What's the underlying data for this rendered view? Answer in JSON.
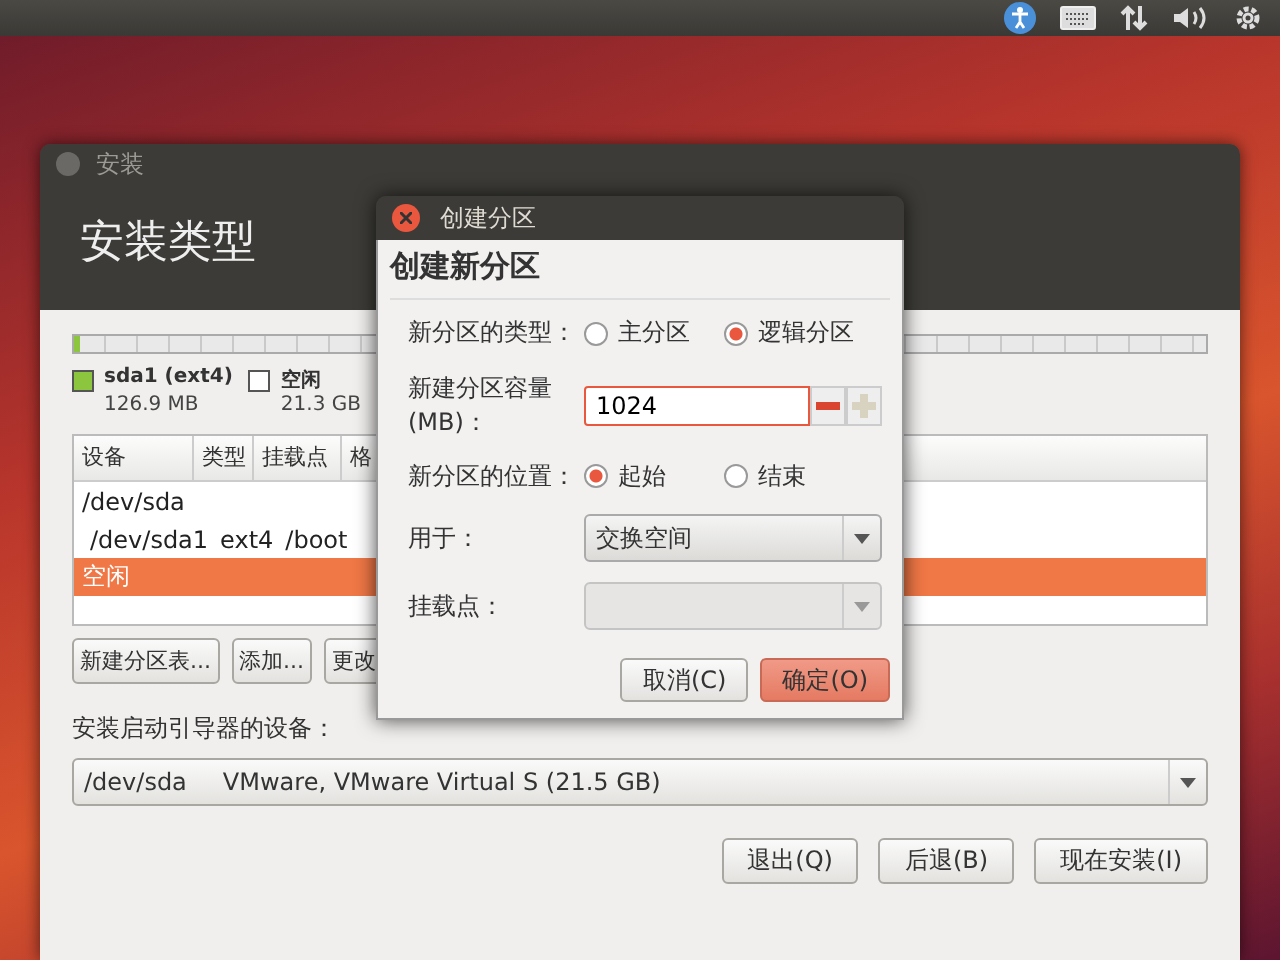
{
  "window": {
    "title": "安装",
    "heading": "安装类型",
    "partition_bar": {
      "segments": [
        {
          "level": 0.006,
          "color": "#8cc63f"
        }
      ]
    },
    "legend": [
      {
        "name": "sda1 (ext4)",
        "size": "126.9 MB",
        "color": "#8cc63f"
      },
      {
        "name": "空闲",
        "size": "21.3 GB",
        "color": "#ffffff"
      }
    ],
    "table": {
      "columns": [
        "设备",
        "类型",
        "挂载点",
        "格"
      ],
      "rows": [
        {
          "cells": [
            "/dev/sda"
          ],
          "selected": false
        },
        {
          "cells": [
            "/dev/sda1",
            "ext4",
            "/boot"
          ],
          "selected": false
        },
        {
          "cells": [
            "空闲"
          ],
          "selected": true
        }
      ]
    },
    "table_buttons": [
      "新建分区表...",
      "添加...",
      "更改"
    ],
    "bootloader_label": "安装启动引导器的设备：",
    "bootloader_device": {
      "device": "/dev/sda",
      "description": "VMware, VMware Virtual S (21.5 GB)"
    },
    "buttons": [
      {
        "label": "退出(Q)"
      },
      {
        "label": "后退(B)"
      },
      {
        "label": "现在安装(I)"
      }
    ]
  },
  "dialog": {
    "title": "创建分区",
    "heading": "创建新分区",
    "type": {
      "label": "新分区的类型：",
      "options": [
        {
          "label": "主分区",
          "selected": false
        },
        {
          "label": "逻辑分区",
          "selected": true
        }
      ]
    },
    "size": {
      "label": "新建分区容量 (MB)：",
      "value": "1024"
    },
    "position": {
      "label": "新分区的位置：",
      "options": [
        {
          "label": "起始",
          "selected": true
        },
        {
          "label": "结束",
          "selected": false
        }
      ]
    },
    "use_as": {
      "label": "用于：",
      "value": "交换空间",
      "disabled": false
    },
    "mount_point": {
      "label": "挂载点：",
      "disabled": true
    },
    "buttons": [
      {
        "label": "取消(C)",
        "default": false
      },
      {
        "label": "确定(O)",
        "default": true
      }
    ]
  }
}
